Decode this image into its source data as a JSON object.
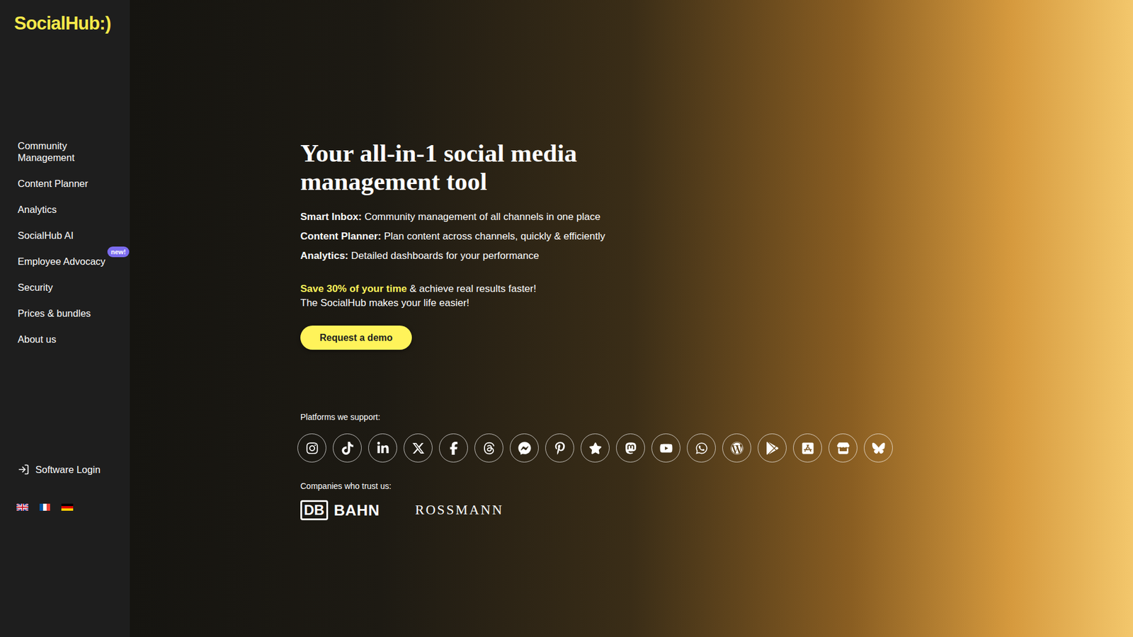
{
  "logo": "SocialHub:)",
  "sidebar": {
    "items": [
      {
        "label": "Community Management",
        "badge": ""
      },
      {
        "label": "Content Planner",
        "badge": ""
      },
      {
        "label": "Analytics",
        "badge": ""
      },
      {
        "label": "SocialHub AI",
        "badge": ""
      },
      {
        "label": "Employee Advocacy",
        "badge": "new!"
      },
      {
        "label": "Security",
        "badge": ""
      },
      {
        "label": "Prices & bundles",
        "badge": ""
      },
      {
        "label": "About us",
        "badge": ""
      }
    ],
    "login": "Software Login"
  },
  "hero": {
    "title": "Your all-in-1 social media management tool",
    "features": [
      {
        "label": "Smart Inbox:",
        "text": "Community management of all channels in one place"
      },
      {
        "label": "Content Planner:",
        "text": "Plan content across channels, quickly & efficiently"
      },
      {
        "label": "Analytics:",
        "text": "Detailed dashboards for your performance"
      }
    ],
    "highlight": "Save 30% of your time",
    "highlight_rest": "& achieve real results faster!",
    "subline": "The SocialHub makes your life easier!",
    "button": "Request a demo",
    "platforms_label": "Platforms we support:",
    "companies_label": "Companies who trust us:",
    "companies": {
      "db_mark": "DB",
      "db_name": "BAHN",
      "rossmann": "ROSSMANN"
    }
  }
}
